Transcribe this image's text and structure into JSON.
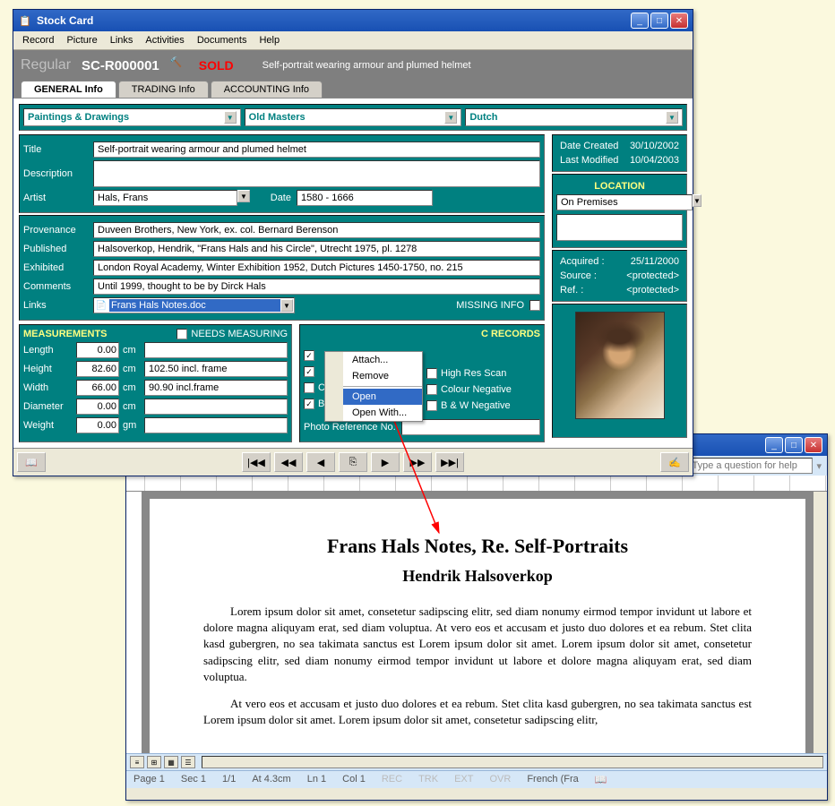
{
  "stockCard": {
    "title": "Stock Card",
    "menubar": [
      "Record",
      "Picture",
      "Links",
      "Activities",
      "Documents",
      "Help"
    ],
    "header": {
      "regular": "Regular",
      "code": "SC-R000001",
      "status": "SOLD",
      "desc": "Self-portrait wearing armour and plumed helmet"
    },
    "tabs": [
      {
        "label": "GENERAL Info",
        "active": true
      },
      {
        "label": "TRADING Info",
        "active": false
      },
      {
        "label": "ACCOUNTING Info",
        "active": false
      }
    ],
    "categories": {
      "c1": "Paintings & Drawings",
      "c2": "Old Masters",
      "c3": "Dutch"
    },
    "fields": {
      "titleLabel": "Title",
      "titleVal": "Self-portrait wearing armour and plumed helmet",
      "descLabel": "Description",
      "descVal": "",
      "artistLabel": "Artist",
      "artistVal": "Hals, Frans",
      "dateLabel": "Date",
      "dateVal": "1580 - 1666",
      "provLabel": "Provenance",
      "provVal": "Duveen Brothers, New York, ex. col. Bernard Berenson",
      "pubLabel": "Published",
      "pubVal": "Halsoverkop, Hendrik, \"Frans Hals and his Circle\", Utrecht 1975, pl. 1278",
      "exhLabel": "Exhibited",
      "exhVal": "London Royal Academy, Winter Exhibition 1952, Dutch Pictures 1450-1750, no. 215",
      "comLabel": "Comments",
      "comVal": "Until 1999, thought to be by Dirck Hals",
      "linksLabel": "Links",
      "linksVal": "Frans Hals Notes.doc",
      "missingLabel": "MISSING INFO"
    },
    "dates": {
      "createdLbl": "Date Created",
      "createdVal": "30/10/2002",
      "modifiedLbl": "Last Modified",
      "modifiedVal": "10/04/2003"
    },
    "location": {
      "header": "LOCATION",
      "value": "On Premises"
    },
    "acquired": {
      "acqLbl": "Acquired :",
      "acqVal": "25/11/2000",
      "srcLbl": "Source :",
      "srcVal": "<protected>",
      "refLbl": "Ref. :",
      "refVal": "<protected>"
    },
    "measurements": {
      "header": "MEASUREMENTS",
      "needsLabel": "NEEDS MEASURING",
      "rows": {
        "lengthLbl": "Length",
        "lengthVal": "0.00",
        "lengthUnit": "cm",
        "lengthExtra": "",
        "heightLbl": "Height",
        "heightVal": "82.60",
        "heightUnit": "cm",
        "heightExtra": "102.50 incl. frame",
        "widthLbl": "Width",
        "widthVal": "66.00",
        "widthUnit": "cm",
        "widthExtra": "90.90 incl.frame",
        "diamLbl": "Diameter",
        "diamVal": "0.00",
        "diamUnit": "cm",
        "diamExtra": "",
        "weightLbl": "Weight",
        "weightVal": "0.00",
        "weightUnit": "gm",
        "weightExtra": ""
      }
    },
    "photoRecords": {
      "partial": "C RECORDS",
      "bwPrint": "B & W  Print",
      "colourPrint": "Colour Print",
      "hiRes": "High Res Scan",
      "colourNeg": "Colour Negative",
      "bwNeg": "B & W  Negative",
      "refLabel": "Photo Reference No."
    },
    "contextMenu": {
      "attach": "Attach...",
      "remove": "Remove",
      "open": "Open",
      "openWith": "Open With..."
    }
  },
  "wordDoc": {
    "helpPlaceholder": "Type a question for help",
    "heading1": "Frans Hals Notes, Re. Self-Portraits",
    "heading2": "Hendrik Halsoverkop",
    "para1": "Lorem ipsum dolor sit amet, consetetur sadipscing elitr, sed diam nonumy eirmod tempor invidunt ut labore et dolore magna aliquyam erat, sed diam voluptua. At vero eos et accusam et justo duo dolores et ea rebum. Stet clita kasd gubergren, no sea takimata sanctus est Lorem ipsum dolor sit amet. Lorem ipsum dolor sit amet, consetetur sadipscing elitr, sed diam nonumy eirmod tempor invidunt ut labore et dolore magna aliquyam erat, sed diam voluptua.",
    "para2": "At vero eos et accusam et justo duo dolores et ea rebum. Stet clita kasd gubergren, no sea takimata sanctus est Lorem ipsum dolor sit amet. Lorem ipsum dolor sit amet, consetetur sadipscing elitr,",
    "status": {
      "page": "Page  1",
      "sec": "Sec  1",
      "pages": "1/1",
      "at": "At  4.3cm",
      "ln": "Ln  1",
      "col": "Col  1",
      "rec": "REC",
      "trk": "TRK",
      "ext": "EXT",
      "ovr": "OVR",
      "lang": "French (Fra"
    }
  }
}
